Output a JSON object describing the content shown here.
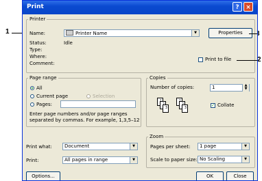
{
  "callouts": {
    "c1": "1",
    "c2": "2",
    "c3": "3"
  },
  "window": {
    "title": "Print",
    "help": "?",
    "close": "×"
  },
  "printer": {
    "group": "Printer",
    "name_label": "Name:",
    "name_value": "Printer Name",
    "properties": "Properties",
    "status_label": "Status:",
    "status_value": "Idle",
    "type_label": "Type:",
    "where_label": "Where:",
    "comment_label": "Comment:",
    "print_to_file": "Print to file"
  },
  "page_range": {
    "group": "Page range",
    "all": "All",
    "current": "Current page",
    "selection": "Selection",
    "pages": "Pages:",
    "hint1": "Enter page numbers and/or page ranges",
    "hint2": "separated by commas.  For example, 1,3,5–12"
  },
  "copies": {
    "group": "Copies",
    "number_label": "Number of copies:",
    "number_value": "1",
    "collate": "Collate",
    "p1": "1",
    "p2": "2",
    "p3": "3"
  },
  "print_what": {
    "label": "Print what:",
    "value": "Document"
  },
  "print": {
    "label": "Print:",
    "value": "All pages in range"
  },
  "zoom": {
    "group": "Zoom",
    "pps_label": "Pages per sheet:",
    "pps_value": "1 page",
    "scale_label": "Scale to paper size:",
    "scale_value": "No Scaling"
  },
  "buttons": {
    "options": "Options...",
    "ok": "OK",
    "close": "Close"
  },
  "colors": {
    "titlebar": "#0a4ad0",
    "dialog": "#ece9d8"
  }
}
